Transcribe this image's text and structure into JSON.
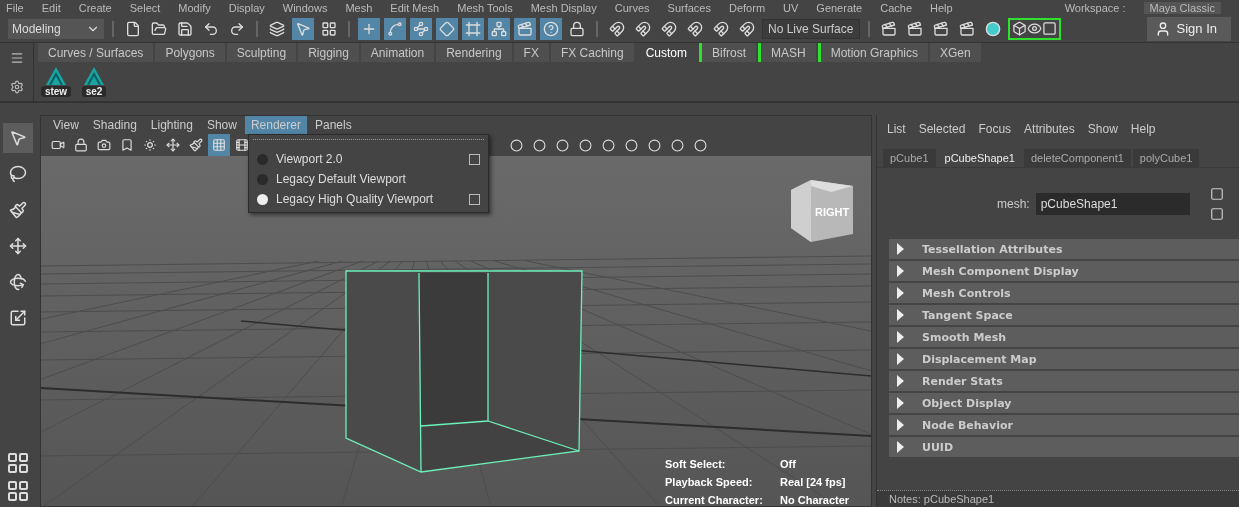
{
  "menu_bar": {
    "items": [
      "File",
      "Edit",
      "Create",
      "Select",
      "Modify",
      "Display",
      "Windows",
      "Mesh",
      "Edit Mesh",
      "Mesh Tools",
      "Mesh Display",
      "Curves",
      "Surfaces",
      "Deform",
      "UV",
      "Generate",
      "Cache",
      "Help"
    ],
    "workspace_label": "Workspace :",
    "workspace": "Maya Classic"
  },
  "status_line": {
    "mode": "Modeling",
    "select_modes": [
      {
        "on": false
      },
      {
        "on": true
      },
      {
        "on": false
      }
    ],
    "masks": [
      {
        "on": true
      },
      {
        "on": true
      },
      {
        "on": true
      },
      {
        "on": true
      },
      {
        "on": true
      },
      {
        "on": true
      },
      {
        "on": true
      },
      {
        "on": true
      }
    ],
    "live_surface": "No Live Surface",
    "sign_in": "Sign In"
  },
  "shelf": {
    "tabs": [
      {
        "label": "Curves / Surfaces",
        "selected": false,
        "bracketed": false
      },
      {
        "label": "Polygons",
        "selected": false,
        "bracketed": false
      },
      {
        "label": "Sculpting",
        "selected": false,
        "bracketed": false
      },
      {
        "label": "Rigging",
        "selected": false,
        "bracketed": false
      },
      {
        "label": "Animation",
        "selected": false,
        "bracketed": false
      },
      {
        "label": "Rendering",
        "selected": false,
        "bracketed": false
      },
      {
        "label": "FX",
        "selected": false,
        "bracketed": false
      },
      {
        "label": "FX Caching",
        "selected": false,
        "bracketed": false
      },
      {
        "label": "Custom",
        "selected": true,
        "bracketed": false
      },
      {
        "label": "Bifrost",
        "selected": false,
        "bracketed": true
      },
      {
        "label": "MASH",
        "selected": false,
        "bracketed": true
      },
      {
        "label": "Motion Graphics",
        "selected": false,
        "bracketed": true
      },
      {
        "label": "XGen",
        "selected": false,
        "bracketed": false
      }
    ],
    "items": [
      {
        "label": "stew"
      },
      {
        "label": "se2"
      }
    ]
  },
  "toolbox": [
    {
      "selected": true
    },
    {
      "selected": false
    },
    {
      "selected": false
    },
    {
      "selected": false
    },
    {
      "selected": false
    },
    {
      "selected": false
    }
  ],
  "viewport": {
    "menu": [
      {
        "label": "View",
        "selected": false
      },
      {
        "label": "Shading",
        "selected": false
      },
      {
        "label": "Lighting",
        "selected": false
      },
      {
        "label": "Show",
        "selected": false
      },
      {
        "label": "Renderer",
        "selected": true
      },
      {
        "label": "Panels",
        "selected": false
      }
    ],
    "toolbar": [
      {
        "on": false
      },
      {
        "on": false
      },
      {
        "on": false
      },
      {
        "on": false
      },
      {
        "on": false
      },
      {
        "on": false
      },
      {
        "on": false
      },
      {
        "on": true
      },
      {
        "on": false
      }
    ],
    "renderer_menu": [
      {
        "label": "Viewport 2.0",
        "selected": false,
        "has_options": true
      },
      {
        "label": "Legacy Default Viewport",
        "selected": false,
        "has_options": false
      },
      {
        "label": "Legacy High Quality Viewport",
        "selected": true,
        "has_options": true
      }
    ],
    "view_cube": "RIGHT",
    "hud": [
      {
        "label": "Soft Select:",
        "value": "Off"
      },
      {
        "label": "Playback Speed:",
        "value": "Real [24 fps]"
      },
      {
        "label": "Current Character:",
        "value": "No Character"
      }
    ]
  },
  "attribute_editor": {
    "menu": [
      "List",
      "Selected",
      "Focus",
      "Attributes",
      "Show",
      "Help"
    ],
    "tabs": [
      {
        "label": "pCube1",
        "selected": false
      },
      {
        "label": "pCubeShape1",
        "selected": true
      },
      {
        "label": "deleteComponent1",
        "selected": false
      },
      {
        "label": "polyCube1",
        "selected": false
      }
    ],
    "mesh_label": "mesh:",
    "mesh_value": "pCubeShape1",
    "sections": [
      {
        "label": "Tessellation Attributes",
        "expanded": false
      },
      {
        "label": "Mesh Component Display",
        "expanded": false
      },
      {
        "label": "Mesh Controls",
        "expanded": false
      },
      {
        "label": "Tangent Space",
        "expanded": false
      },
      {
        "label": "Smooth Mesh",
        "expanded": false
      },
      {
        "label": "Displacement Map",
        "expanded": false
      },
      {
        "label": "Render Stats",
        "expanded": false
      },
      {
        "label": "Object Display",
        "expanded": false
      },
      {
        "label": "Node Behavior",
        "expanded": false
      },
      {
        "label": "UUID",
        "expanded": false
      }
    ],
    "notes": "Notes: pCubeShape1"
  }
}
